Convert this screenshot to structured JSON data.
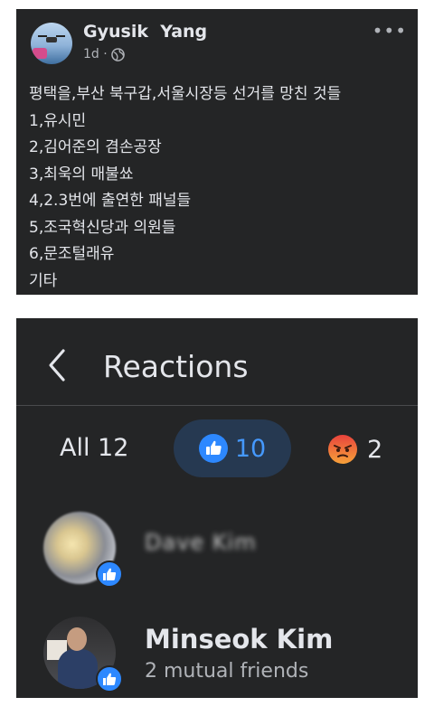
{
  "post": {
    "author": "Gyusik  Yang",
    "time": "1d ·",
    "lines": [
      "평택을,부산 북구갑,서울시장등 선거를 망친 것들",
      "1,유시민",
      "2,김어준의 겸손공장",
      "3,최욱의 매불쑈",
      "4,2.3번에 출연한 패널들",
      "5,조국혁신당과 의원들",
      "6,문조털래유",
      "기타"
    ],
    "more_icon": "•••"
  },
  "reactions": {
    "title": "Reactions",
    "tabs": {
      "all_label": "All 12",
      "like_count": "10",
      "angry_count": "2"
    },
    "people": [
      {
        "name": "Dave Kim",
        "subtitle": ""
      },
      {
        "name": "Minseok Kim",
        "subtitle": "2 mutual friends"
      }
    ],
    "colors": {
      "like_blue": "#2d88ff",
      "angry_orange": "#f5603c",
      "panel_bg": "#242526",
      "selected_tab_bg": "#263951"
    }
  }
}
